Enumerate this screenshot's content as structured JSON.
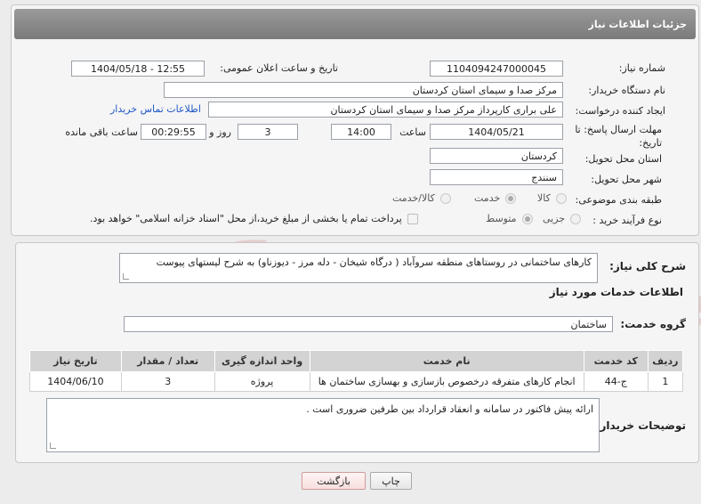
{
  "header": {
    "title": "جزئیات اطلاعات نیاز"
  },
  "form": {
    "need_number_label": "شماره نیاز:",
    "need_number": "1104094247000045",
    "announce_label": "تاریخ و ساعت اعلان عمومی:",
    "announce_value": "1404/05/18 - 12:55",
    "buyer_org_label": "نام دستگاه خریدار:",
    "buyer_org": "مرکز صدا و سیمای استان کردستان",
    "creator_label": "ایجاد کننده درخواست:",
    "creator": "علی براری کارپرداز مرکز صدا و سیمای استان کردستان",
    "contact_link": "اطلاعات تماس خریدار",
    "deadline_label_1": "مهلت ارسال پاسخ: تا",
    "deadline_label_2": "تاریخ:",
    "deadline_date": "1404/05/21",
    "time_label": "ساعت",
    "deadline_time": "14:00",
    "days_value": "3",
    "days_label": "روز و",
    "remaining_time": "00:29:55",
    "remaining_label": "ساعت باقی مانده",
    "province_label": "استان محل تحویل:",
    "province": "کردستان",
    "city_label": "شهر محل تحویل:",
    "city": "سنندج",
    "category_label": "طبقه بندی موضوعی:",
    "category_options": [
      "کالا",
      "خدمت",
      "کالا/خدمت"
    ],
    "category_selected": "خدمت",
    "process_label": "نوع فرآیند خرید :",
    "process_options": [
      "جزیی",
      "متوسط"
    ],
    "process_selected": "متوسط",
    "payment_note": "پرداخت تمام یا بخشی از مبلغ خرید،از محل \"اسناد خزانه اسلامی\" خواهد بود."
  },
  "description": {
    "label": "شرح کلی نیاز:",
    "text": "کارهای ساختمانی در روستاهای منطقه سروآباد ( درگاه شیخان - دله مرز - دیوزناو) به شرح لیستهای پیوست"
  },
  "services": {
    "section_title": "اطلاعات خدمات مورد نیاز",
    "group_label": "گروه خدمت:",
    "group_value": "ساختمان",
    "columns": [
      "ردیف",
      "کد خدمت",
      "نام خدمت",
      "واحد اندازه گیری",
      "تعداد / مقدار",
      "تاریخ نیاز"
    ],
    "rows": [
      [
        "1",
        "ج-44",
        "انجام کارهای متفرقه درخصوص بازسازی و بهسازی ساختمان ها",
        "پروژه",
        "3",
        "1404/06/10"
      ]
    ]
  },
  "buyer_notes": {
    "label": "توضیحات خریدار:",
    "text": "ارائه پیش فاکتور در سامانه و انعقاد قرارداد بین طرفین ضروری است ."
  },
  "buttons": {
    "print": "چاپ",
    "back": "بازگشت"
  },
  "watermark": {
    "text": "AriaTender.neT"
  }
}
